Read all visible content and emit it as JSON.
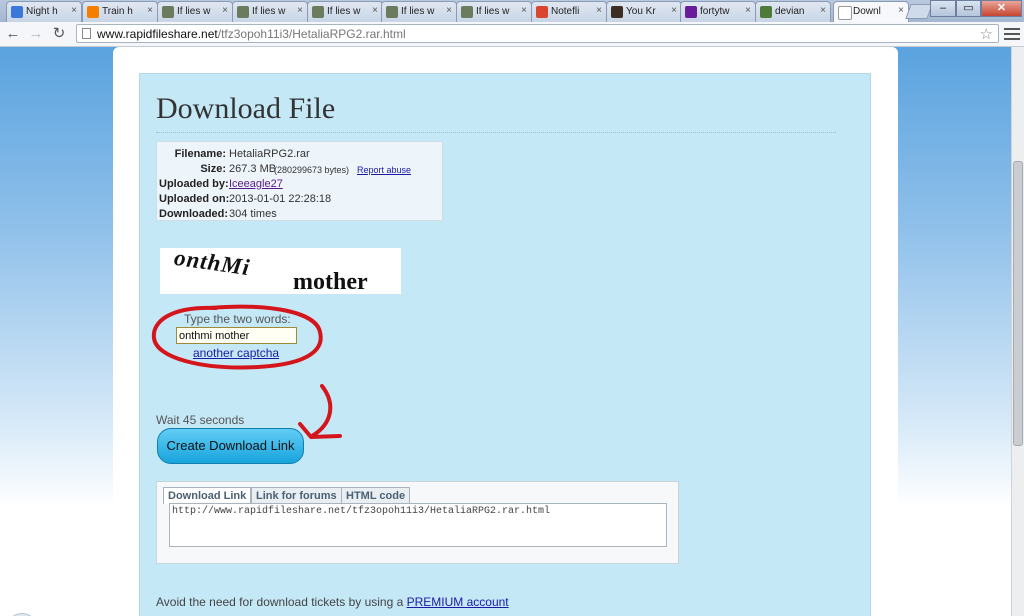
{
  "browser": {
    "tabs": [
      {
        "title": "Night h",
        "icon": "docs-icon",
        "color": "#3a77d8"
      },
      {
        "title": "Train h",
        "icon": "blogger-icon",
        "color": "#f57d00"
      },
      {
        "title": "If lies w",
        "icon": "image-icon",
        "color": "#6b7b5e"
      },
      {
        "title": "If lies w",
        "icon": "image-icon",
        "color": "#6b7b5e"
      },
      {
        "title": "If lies w",
        "icon": "image-icon",
        "color": "#6b7b5e"
      },
      {
        "title": "If lies w",
        "icon": "image-icon",
        "color": "#6b7b5e"
      },
      {
        "title": "If lies w",
        "icon": "image-icon",
        "color": "#6b7b5e"
      },
      {
        "title": "Notefli",
        "icon": "notefl-icon",
        "color": "#d9452f"
      },
      {
        "title": "You Kr",
        "icon": "video-icon",
        "color": "#3c2e22"
      },
      {
        "title": "fortytw",
        "icon": "yahoo-icon",
        "color": "#6a1b9a"
      },
      {
        "title": "devian",
        "icon": "deviantart-icon",
        "color": "#4e7a3a"
      },
      {
        "title": "Downl",
        "icon": "page-icon",
        "color": "#ffffff"
      }
    ],
    "active_tab_index": 11,
    "url_host": "www.rapidfileshare.net",
    "url_path": "/tfz3opoh11i3/HetaliaRPG2.rar.html",
    "close_glyph": "×"
  },
  "page": {
    "title": "Download File",
    "file_info": {
      "filename_label": "Filename:",
      "filename": "HetaliaRPG2.rar",
      "size_label": "Size:",
      "size": "267.3 MB",
      "size_bytes": "(280299673 bytes)",
      "report_abuse": "Report abuse",
      "uploaded_by_label": "Uploaded by:",
      "uploaded_by": "Iceeagle27",
      "uploaded_on_label": "Uploaded on:",
      "uploaded_on": "2013-01-01 22:28:18",
      "downloaded_label": "Downloaded:",
      "downloaded": "304 times"
    },
    "captcha": {
      "word1": "onthMi",
      "word2": "mother",
      "prompt": "Type the two words:",
      "input_value": "onthmi mother",
      "another_link": "another captcha"
    },
    "wait_text": "Wait 45 seconds",
    "create_button": "Create Download Link",
    "link_tabs": [
      "Download Link",
      "Link for forums",
      "HTML code"
    ],
    "link_value": "http://www.rapidfileshare.net/tfz3opoh11i3/HetaliaRPG2.rar.html",
    "premium_prefix": "Avoid the need for download tickets by using a ",
    "premium_link": "PREMIUM account",
    "annotation_color": "#d4161c"
  }
}
